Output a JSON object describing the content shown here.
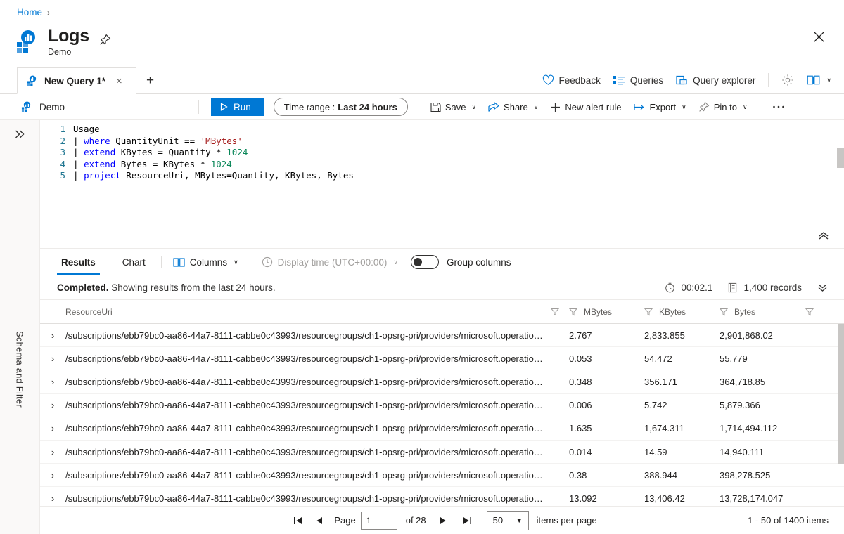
{
  "breadcrumb": {
    "home": "Home",
    "separator": "›"
  },
  "header": {
    "title": "Logs",
    "subtitle": "Demo",
    "pin_icon": "pin-icon",
    "more_icon": "ellipsis-icon",
    "close_icon": "close-icon"
  },
  "tabstrip": {
    "tab_label": "New Query 1*",
    "close_label": "×",
    "add_label": "+",
    "tools": [
      {
        "label": "Feedback",
        "icon": "heart-icon"
      },
      {
        "label": "Queries",
        "icon": "list-icon"
      },
      {
        "label": "Query explorer",
        "icon": "window-icon"
      }
    ],
    "settings_icon": "gear-icon",
    "book_icon": "book-icon",
    "book_chevron": "∨"
  },
  "commandbar": {
    "scope": "Demo",
    "run_label": "Run",
    "run_icon": "play-icon",
    "time_range_label": "Time range :",
    "time_range_value": "Last 24 hours",
    "commands": [
      {
        "label": "Save",
        "icon": "save-icon",
        "chevron": "∨"
      },
      {
        "label": "Share",
        "icon": "share-icon",
        "chevron": "∨"
      },
      {
        "label": "New alert rule",
        "icon": "plus-icon",
        "chevron": ""
      },
      {
        "label": "Export",
        "icon": "export-icon",
        "chevron": "∨"
      },
      {
        "label": "Pin to",
        "icon": "pin-icon",
        "chevron": "∨"
      }
    ],
    "overflow": "···"
  },
  "rail": {
    "expand_icon": "double-chevron-right-icon",
    "label": "Schema and Filter"
  },
  "editor": {
    "collapse_icon": "double-chevron-up-icon",
    "lines": [
      {
        "n": "1",
        "tokens": [
          {
            "t": "Usage",
            "c": "plain"
          }
        ]
      },
      {
        "n": "2",
        "tokens": [
          {
            "t": "| ",
            "c": "plain"
          },
          {
            "t": "where",
            "c": "kw"
          },
          {
            "t": " QuantityUnit == ",
            "c": "plain"
          },
          {
            "t": "'MBytes'",
            "c": "str"
          }
        ]
      },
      {
        "n": "3",
        "tokens": [
          {
            "t": "| ",
            "c": "plain"
          },
          {
            "t": "extend",
            "c": "kw"
          },
          {
            "t": " KBytes = Quantity * ",
            "c": "plain"
          },
          {
            "t": "1024",
            "c": "num"
          }
        ]
      },
      {
        "n": "4",
        "tokens": [
          {
            "t": "| ",
            "c": "plain"
          },
          {
            "t": "extend",
            "c": "kw"
          },
          {
            "t": " Bytes = KBytes * ",
            "c": "plain"
          },
          {
            "t": "1024",
            "c": "num"
          }
        ]
      },
      {
        "n": "5",
        "tokens": [
          {
            "t": "| ",
            "c": "plain"
          },
          {
            "t": "project",
            "c": "kw"
          },
          {
            "t": " ResourceUri, MBytes=Quantity, KBytes, Bytes",
            "c": "plain"
          }
        ]
      }
    ]
  },
  "results": {
    "tabs": [
      {
        "label": "Results",
        "active": true
      },
      {
        "label": "Chart",
        "active": false
      }
    ],
    "columns_label": "Columns",
    "columns_icon": "columns-icon",
    "columns_chevron": "∨",
    "display_time_label": "Display time (UTC+00:00)",
    "display_time_icon": "clock-icon",
    "display_time_chevron": "∨",
    "group_columns_label": "Group columns",
    "group_columns_on": false
  },
  "status": {
    "completed": "Completed.",
    "message": "Showing results from the last 24 hours.",
    "timer_icon": "timer-icon",
    "timer": "00:02.1",
    "records_icon": "records-icon",
    "records": "1,400 records",
    "expand_icon": "double-chevron-down-icon"
  },
  "table": {
    "columns": [
      {
        "key": "ResourceUri",
        "label": "ResourceUri",
        "filter_icon": "filter-icon"
      },
      {
        "key": "MBytes",
        "label": "MBytes",
        "filter_icon": "filter-icon"
      },
      {
        "key": "KBytes",
        "label": "KBytes",
        "filter_icon": "filter-icon"
      },
      {
        "key": "Bytes",
        "label": "Bytes",
        "filter_icon": "filter-icon"
      }
    ],
    "expand_glyph": "›",
    "rows": [
      {
        "ResourceUri": "/subscriptions/ebb79bc0-aa86-44a7-8111-cabbe0c43993/resourcegroups/ch1-opsrg-pri/providers/microsoft.operatio…",
        "MBytes": "2.767",
        "KBytes": "2,833.855",
        "Bytes": "2,901,868.02"
      },
      {
        "ResourceUri": "/subscriptions/ebb79bc0-aa86-44a7-8111-cabbe0c43993/resourcegroups/ch1-opsrg-pri/providers/microsoft.operatio…",
        "MBytes": "0.053",
        "KBytes": "54.472",
        "Bytes": "55,779"
      },
      {
        "ResourceUri": "/subscriptions/ebb79bc0-aa86-44a7-8111-cabbe0c43993/resourcegroups/ch1-opsrg-pri/providers/microsoft.operatio…",
        "MBytes": "0.348",
        "KBytes": "356.171",
        "Bytes": "364,718.85"
      },
      {
        "ResourceUri": "/subscriptions/ebb79bc0-aa86-44a7-8111-cabbe0c43993/resourcegroups/ch1-opsrg-pri/providers/microsoft.operatio…",
        "MBytes": "0.006",
        "KBytes": "5.742",
        "Bytes": "5,879.366"
      },
      {
        "ResourceUri": "/subscriptions/ebb79bc0-aa86-44a7-8111-cabbe0c43993/resourcegroups/ch1-opsrg-pri/providers/microsoft.operatio…",
        "MBytes": "1.635",
        "KBytes": "1,674.311",
        "Bytes": "1,714,494.112"
      },
      {
        "ResourceUri": "/subscriptions/ebb79bc0-aa86-44a7-8111-cabbe0c43993/resourcegroups/ch1-opsrg-pri/providers/microsoft.operatio…",
        "MBytes": "0.014",
        "KBytes": "14.59",
        "Bytes": "14,940.111"
      },
      {
        "ResourceUri": "/subscriptions/ebb79bc0-aa86-44a7-8111-cabbe0c43993/resourcegroups/ch1-opsrg-pri/providers/microsoft.operatio…",
        "MBytes": "0.38",
        "KBytes": "388.944",
        "Bytes": "398,278.525"
      },
      {
        "ResourceUri": "/subscriptions/ebb79bc0-aa86-44a7-8111-cabbe0c43993/resourcegroups/ch1-opsrg-pri/providers/microsoft.operatio…",
        "MBytes": "13.092",
        "KBytes": "13,406.42",
        "Bytes": "13,728,174.047"
      }
    ]
  },
  "pager": {
    "first_icon": "first-page-icon",
    "prev_icon": "prev-page-icon",
    "page_label": "Page",
    "page_value": "1",
    "of_label": "of 28",
    "next_icon": "next-page-icon",
    "last_icon": "last-page-icon",
    "page_size": "50",
    "page_size_chevron": "▼",
    "items_per_page_label": "items per page",
    "range_label": "1 - 50 of 1400 items"
  }
}
